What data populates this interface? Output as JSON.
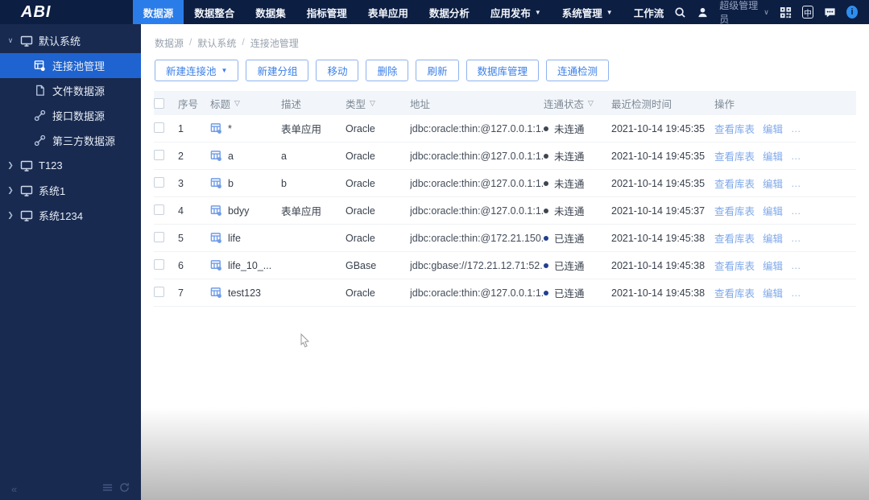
{
  "app": {
    "logo": "ABI"
  },
  "topnav": {
    "items": [
      {
        "label": "数据源",
        "active": true,
        "caret": false
      },
      {
        "label": "数据整合",
        "active": false,
        "caret": false
      },
      {
        "label": "数据集",
        "active": false,
        "caret": false
      },
      {
        "label": "指标管理",
        "active": false,
        "caret": false
      },
      {
        "label": "表单应用",
        "active": false,
        "caret": false
      },
      {
        "label": "数据分析",
        "active": false,
        "caret": false
      },
      {
        "label": "应用发布",
        "active": false,
        "caret": true
      },
      {
        "label": "系统管理",
        "active": false,
        "caret": true
      },
      {
        "label": "工作流",
        "active": false,
        "caret": false
      }
    ],
    "user": {
      "name": "超级管理员"
    },
    "language_badge": "中",
    "info_badge": "i"
  },
  "sidebar": {
    "groups": [
      {
        "label": "默认系统",
        "expanded": true,
        "children": [
          {
            "label": "连接池管理",
            "icon": "connection-pool",
            "selected": true
          },
          {
            "label": "文件数据源",
            "icon": "file",
            "selected": false
          },
          {
            "label": "接口数据源",
            "icon": "api-link",
            "selected": false
          },
          {
            "label": "第三方数据源",
            "icon": "third-party-link",
            "selected": false
          }
        ]
      },
      {
        "label": "T123",
        "expanded": false,
        "children": []
      },
      {
        "label": "系统1",
        "expanded": false,
        "children": []
      },
      {
        "label": "系统1234",
        "expanded": false,
        "children": []
      }
    ],
    "footer": {
      "collapse": "«"
    }
  },
  "breadcrumb": {
    "items": [
      "数据源",
      "默认系统",
      "连接池管理"
    ],
    "separator": "/"
  },
  "toolbar": {
    "buttons": [
      {
        "label": "新建连接池",
        "caret": true
      },
      {
        "label": "新建分组",
        "caret": false
      },
      {
        "label": "移动",
        "caret": false
      },
      {
        "label": "删除",
        "caret": false
      },
      {
        "label": "刷新",
        "caret": false
      },
      {
        "label": "数据库管理",
        "caret": false
      },
      {
        "label": "连通检测",
        "caret": false
      }
    ]
  },
  "table": {
    "headers": [
      {
        "label": "序号",
        "filter": false
      },
      {
        "label": "标题",
        "filter": true
      },
      {
        "label": "描述",
        "filter": false
      },
      {
        "label": "类型",
        "filter": true
      },
      {
        "label": "地址",
        "filter": false
      },
      {
        "label": "连通状态",
        "filter": true
      },
      {
        "label": "最近检测时间",
        "filter": false
      },
      {
        "label": "操作",
        "filter": false
      }
    ],
    "rows": [
      {
        "num": "1",
        "title": "*",
        "desc": "表单应用",
        "type": "Oracle",
        "address": "jdbc:oracle:thin:@127.0.0.1:1...",
        "status": "未连通",
        "connected": false,
        "checked_time": "2021-10-14 19:45:35"
      },
      {
        "num": "2",
        "title": "a",
        "desc": "a",
        "type": "Oracle",
        "address": "jdbc:oracle:thin:@127.0.0.1:1...",
        "status": "未连通",
        "connected": false,
        "checked_time": "2021-10-14 19:45:35"
      },
      {
        "num": "3",
        "title": "b",
        "desc": "b",
        "type": "Oracle",
        "address": "jdbc:oracle:thin:@127.0.0.1:1...",
        "status": "未连通",
        "connected": false,
        "checked_time": "2021-10-14 19:45:35"
      },
      {
        "num": "4",
        "title": "bdyy",
        "desc": "表单应用",
        "type": "Oracle",
        "address": "jdbc:oracle:thin:@127.0.0.1:1...",
        "status": "未连通",
        "connected": false,
        "checked_time": "2021-10-14 19:45:37"
      },
      {
        "num": "5",
        "title": "life",
        "desc": "",
        "type": "Oracle",
        "address": "jdbc:oracle:thin:@172.21.150....",
        "status": "已连通",
        "connected": true,
        "checked_time": "2021-10-14 19:45:38"
      },
      {
        "num": "6",
        "title": "life_10_...",
        "desc": "",
        "type": "GBase",
        "address": "jdbc:gbase://172.21.12.71:52...",
        "status": "已连通",
        "connected": true,
        "checked_time": "2021-10-14 19:45:38"
      },
      {
        "num": "7",
        "title": "test123",
        "desc": "",
        "type": "Oracle",
        "address": "jdbc:oracle:thin:@127.0.0.1:1...",
        "status": "已连通",
        "connected": true,
        "checked_time": "2021-10-14 19:45:38"
      }
    ],
    "row_actions": [
      "查看库表",
      "编辑",
      "…"
    ]
  },
  "status_colors": {
    "connected": "#1f3f8f",
    "disconnected": "#3f4650"
  }
}
